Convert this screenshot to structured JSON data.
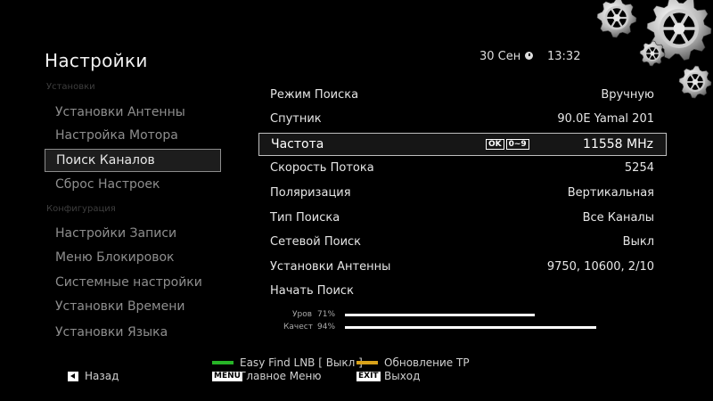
{
  "header": {
    "title": "Настройки",
    "date": "30 Сен",
    "time": "13:32"
  },
  "sidebar": {
    "section1": "Установки",
    "section2": "Конфигурация",
    "items": [
      {
        "label": "Установки Антенны"
      },
      {
        "label": "Настройка Мотора"
      },
      {
        "label": "Поиск Каналов",
        "selected": true
      },
      {
        "label": "Сброс Настроек"
      },
      {
        "label": "Настройки Записи"
      },
      {
        "label": "Меню Блокировок"
      },
      {
        "label": "Системные настройки"
      },
      {
        "label": "Установки Времени"
      },
      {
        "label": "Установки Языка"
      }
    ]
  },
  "main": {
    "rows": [
      {
        "label": "Режим Поиска",
        "value": "Вручную"
      },
      {
        "label": "Спутник",
        "value": "90.0E Yamal 201"
      },
      {
        "label": "Частота",
        "value": "11558 MHz",
        "selected": true
      },
      {
        "label": "Скорость Потока",
        "value": "5254"
      },
      {
        "label": "Поляризация",
        "value": "Вертикальная"
      },
      {
        "label": "Тип Поиска",
        "value": "Все Каналы"
      },
      {
        "label": "Сетевой Поиск",
        "value": "Выкл"
      },
      {
        "label": "Установки Антенны",
        "value": "9750, 10600, 2/10"
      },
      {
        "label": "Начать Поиск",
        "value": ""
      }
    ],
    "hint_ok": "OK",
    "hint_digits": "0~9"
  },
  "signal": {
    "level_label": "Уров",
    "level_value": "71%",
    "level_fraction": 0.71,
    "quality_label": "Качест",
    "quality_value": "94%",
    "quality_fraction": 0.94
  },
  "footer": {
    "back": "Назад",
    "green": "Easy Find LNB [ Выкл ]",
    "yellow": "Обновление TP",
    "menu_key": "MENU",
    "menu_label": "Главное Меню",
    "exit_key": "EXIT",
    "exit_label": "Выход"
  },
  "colors": {
    "green_key": "#27b427",
    "yellow_key": "#d8a21a"
  }
}
